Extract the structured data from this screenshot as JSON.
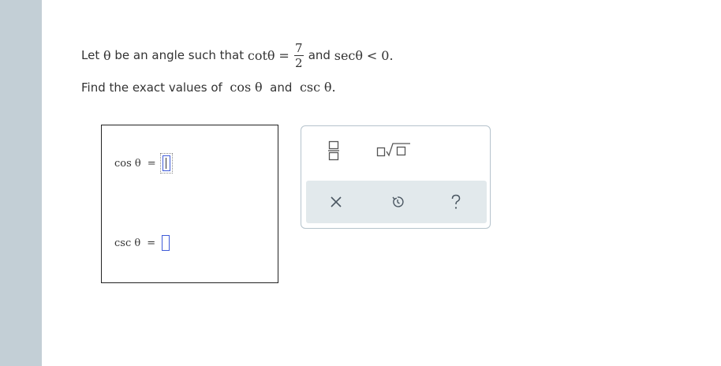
{
  "question": {
    "let_text": "Let",
    "theta": "θ",
    "be_angle_text": "be an angle such that",
    "cot_label": "cot",
    "equals": "=",
    "frac_num": "7",
    "frac_den": "2",
    "and_text": "and",
    "sec_label": "sec",
    "less_zero": "< 0.",
    "find_text": "Find the exact values of",
    "cos_label": "cos",
    "and_text2": "and",
    "csc_label": "csc",
    "period": "."
  },
  "answers": {
    "cos_label": "cos θ",
    "csc_label": "csc θ",
    "equals": "="
  },
  "palette": {
    "fraction_icon": "fraction-icon",
    "sqrt_icon": "square-root-icon",
    "clear_icon": "close-icon",
    "undo_icon": "undo-icon",
    "help_icon": "help-icon",
    "accent": "#3f5bd8"
  }
}
